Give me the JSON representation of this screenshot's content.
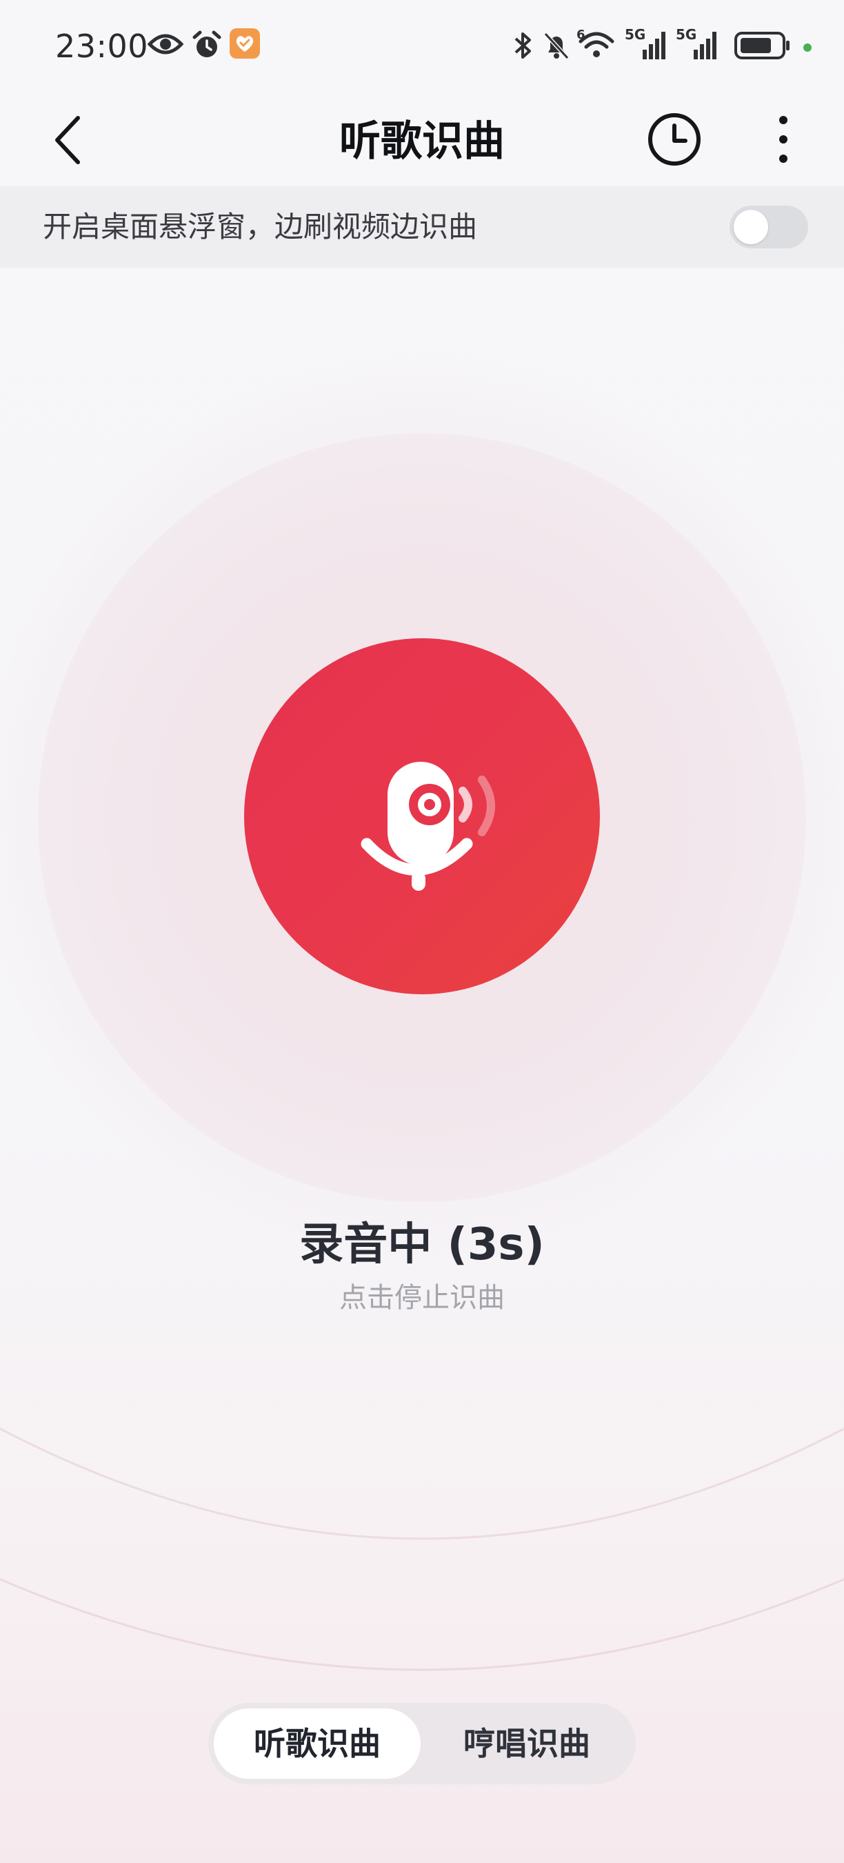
{
  "status_bar": {
    "time": "23:00",
    "signal_1_label": "5G",
    "signal_2_label": "5G",
    "wifi_label": "6",
    "icons": [
      "eye-icon",
      "alarm-icon",
      "app-badge-icon",
      "bluetooth-icon",
      "bell-off-icon",
      "wifi-icon",
      "signal-icon",
      "signal-icon",
      "battery-icon"
    ],
    "indicator_color": "#4caf50"
  },
  "header": {
    "title": "听歌识曲",
    "icons": [
      "back-arrow-icon",
      "history-clock-icon",
      "more-vertical-icon"
    ]
  },
  "float_banner": {
    "text": "开启桌面悬浮窗，边刷视频边识曲",
    "toggle_on": false
  },
  "recorder": {
    "status": "录音中 (3s)",
    "hint": "点击停止识曲",
    "icon": "microphone-sound-icon",
    "accent_color": "#e6334f"
  },
  "mode_switch": {
    "tabs": [
      {
        "label": "听歌识曲",
        "active": true
      },
      {
        "label": "哼唱识曲",
        "active": false
      }
    ]
  }
}
